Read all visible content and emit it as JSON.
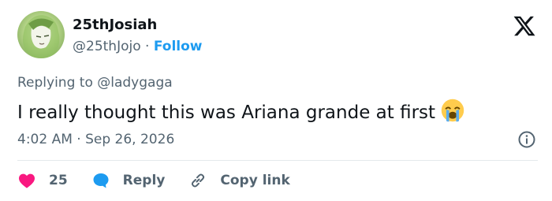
{
  "author": {
    "display_name": "25thJosiah",
    "handle": "@25thJojo",
    "separator": "·",
    "follow_label": "Follow"
  },
  "replying": {
    "prefix": "Replying to",
    "mention": "@ladygaga"
  },
  "tweet": {
    "text": "I really thought this was Ariana grande at first",
    "emoji": "loudly-crying-face"
  },
  "meta": {
    "time": "4:02 AM",
    "separator": "·",
    "date": "Sep 26, 2026"
  },
  "actions": {
    "likes": "25",
    "reply_label": "Reply",
    "copy_label": "Copy link"
  },
  "colors": {
    "link": "#1d9bf0",
    "heart": "#f91880",
    "text": "#0f1419",
    "muted": "#536471"
  }
}
